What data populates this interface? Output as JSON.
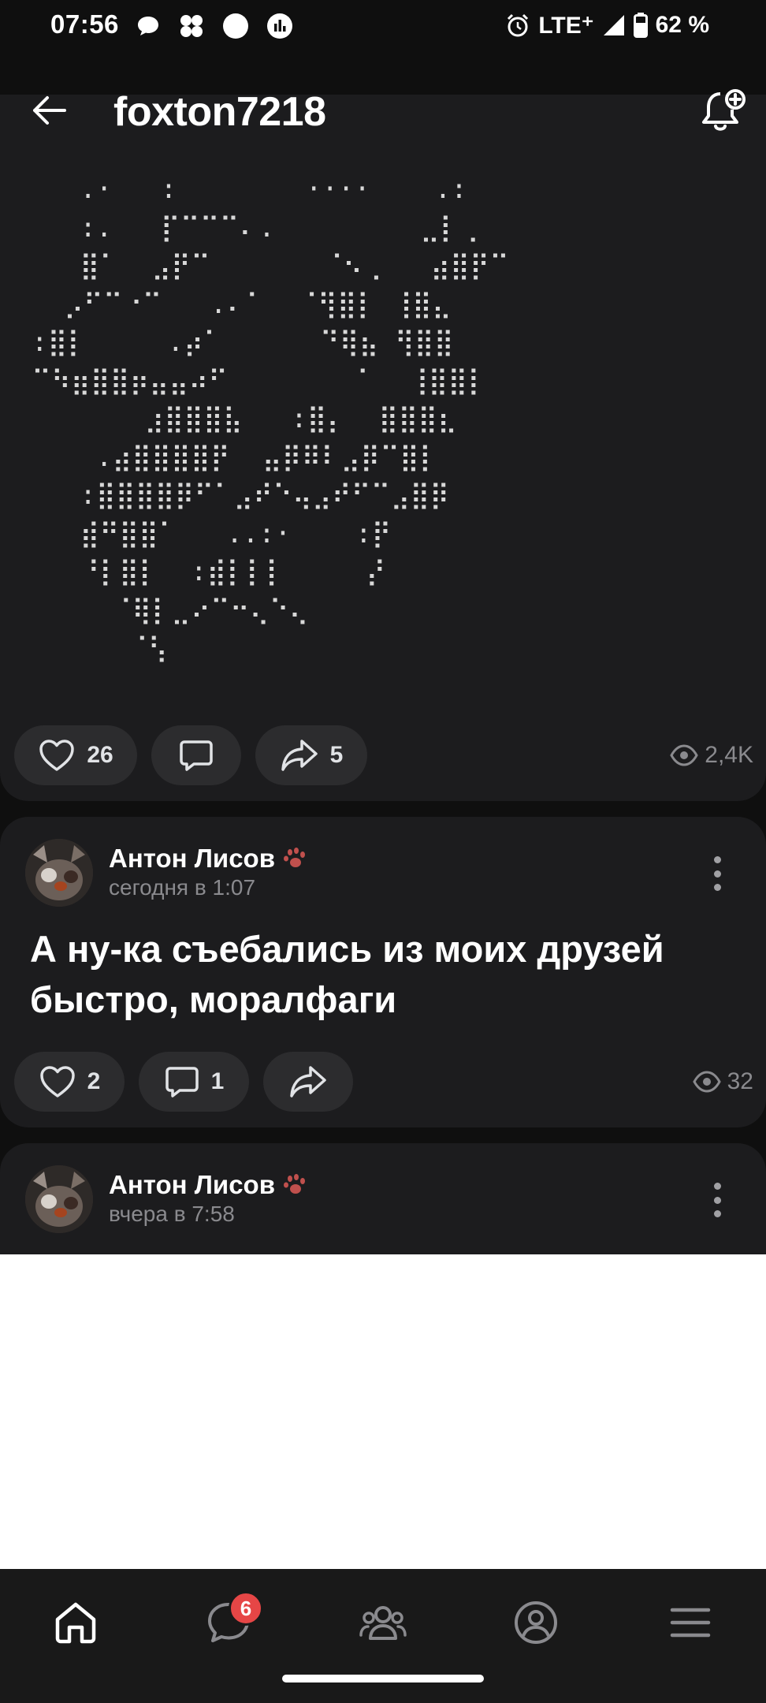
{
  "status_bar": {
    "time": "07:56",
    "network": "LTE⁺",
    "battery": "62 %"
  },
  "header": {
    "title": "foxton7218"
  },
  "posts": [
    {
      "ascii_art": "   .·   :        ····    .:\n   :.   ⡏⠉⠉⠉⠄.         ⣀⡇⢀\n   ⣿⠁  ⣠⡟⠉       ⠈⠢⢀   ⣴⣿⡟⠉\n  ⡠⠋⠉⠐⠉   .⠄⠁  ⠈⢻⣿⡇ ⢸⣿⣄\n:⣿⡇     .⡴⠁      ⠙⢿⣦ ⢻⣿⣿\n⠉⠳⣶⣿⣿⡶⣤⣤⠴⠋        ⠁  ⢸⣿⣿⡇\n       ⣰⣿⣿⣿⣧   :⣿⡄  ⣿⣿⣿⣆\n    .⣴⣿⣿⣿⣿⡟  ⣤⡿⠿⠇⣠⡿⠉⣿⡇\n   :⣿⣿⣿⣿⡿⠋⠁⣠⠞⠑⢤⣠⠞⠋⠉⣠⣿⡿\n   ⣾⠛⣿⣿⠁   ..:·    :⡟\n   ⠘⡇⣿⡇  :⣾⡇⡇⡇     ⡜\n     ⠈⢿⡇⣀⠔⠉⠒⢄⠑⢄\n      ⠈⢣",
      "likes": "26",
      "comments": "",
      "shares": "5",
      "views": "2,4K"
    },
    {
      "author": "Антон Лисов",
      "time": "сегодня в 1:07",
      "text": "А ну-ка съебались из моих друзей быстро, моралфаги",
      "likes": "2",
      "comments": "1",
      "shares": "",
      "views": "32"
    },
    {
      "author": "Антон Лисов",
      "time": "вчера в 7:58"
    }
  ],
  "bottom_nav": {
    "messages_badge": "6"
  },
  "colors": {
    "background": "#0f0f0f",
    "card": "#1c1c1e",
    "pill": "#2c2c2e",
    "badge": "#e64646",
    "paw": "#c0504d"
  }
}
